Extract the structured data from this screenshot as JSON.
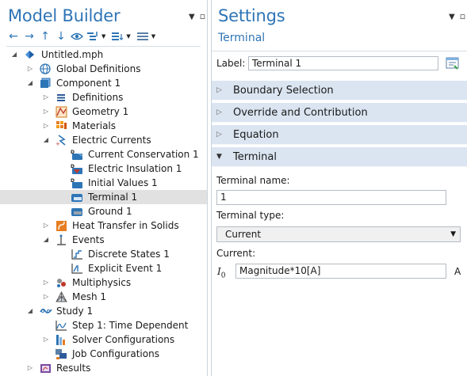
{
  "model_builder": {
    "title": "Model Builder",
    "tree": [
      {
        "label": "Untitled.mph"
      },
      {
        "label": "Global Definitions"
      },
      {
        "label": "Component 1"
      },
      {
        "label": "Definitions"
      },
      {
        "label": "Geometry 1"
      },
      {
        "label": "Materials"
      },
      {
        "label": "Electric Currents"
      },
      {
        "label": "Current Conservation 1"
      },
      {
        "label": "Electric Insulation 1"
      },
      {
        "label": "Initial Values 1"
      },
      {
        "label": "Terminal 1"
      },
      {
        "label": "Ground 1"
      },
      {
        "label": "Heat Transfer in Solids"
      },
      {
        "label": "Events"
      },
      {
        "label": "Discrete States 1"
      },
      {
        "label": "Explicit Event 1"
      },
      {
        "label": "Multiphysics"
      },
      {
        "label": "Mesh 1"
      },
      {
        "label": "Study 1"
      },
      {
        "label": "Step 1: Time Dependent"
      },
      {
        "label": "Solver Configurations"
      },
      {
        "label": "Job Configurations"
      },
      {
        "label": "Results"
      }
    ]
  },
  "settings": {
    "title": "Settings",
    "subtitle": "Terminal",
    "label_caption": "Label:",
    "label_value": "Terminal 1",
    "sections": {
      "boundary": "Boundary Selection",
      "override": "Override and Contribution",
      "equation": "Equation",
      "terminal": "Terminal"
    },
    "terminal_name_caption": "Terminal name:",
    "terminal_name_value": "1",
    "terminal_type_caption": "Terminal type:",
    "terminal_type_value": "Current",
    "current_caption": "Current:",
    "current_symbol": "I",
    "current_subscript": "0",
    "current_value": "Magnitude*10[A]",
    "current_unit": "A"
  },
  "colors": {
    "title_blue": "#2e75b6",
    "section_bg": "#dbe5f1",
    "selected_row": "#e1e1e1"
  }
}
